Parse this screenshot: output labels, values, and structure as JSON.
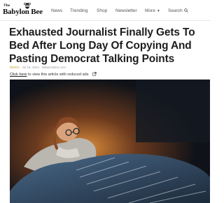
{
  "site": {
    "logo_top": "The",
    "logo_name": "Babylon Bee"
  },
  "nav": {
    "items": [
      {
        "label": "News"
      },
      {
        "label": "Trending"
      },
      {
        "label": "Shop"
      },
      {
        "label": "Newsletter"
      },
      {
        "label": "More"
      },
      {
        "label": "Search"
      }
    ]
  },
  "article": {
    "headline": "Exhausted Journalist Finally Gets To Bed After Long Day Of Copying And Pasting Democrat Talking Points",
    "byline_author": "NEWS",
    "byline_rest": " · Jul 16, 2024 · BabylonBee.com",
    "ads_link": "Click here",
    "ads_text": " to view this article with reduced ads",
    "hero_alt": "Journalist asleep in bed"
  },
  "colors": {
    "accent_gold": "#c9a02a",
    "headline": "#1d1d1d"
  },
  "icons": [
    "bee-logo-icon",
    "chevron-down-icon",
    "search-icon",
    "external-link-icon"
  ]
}
